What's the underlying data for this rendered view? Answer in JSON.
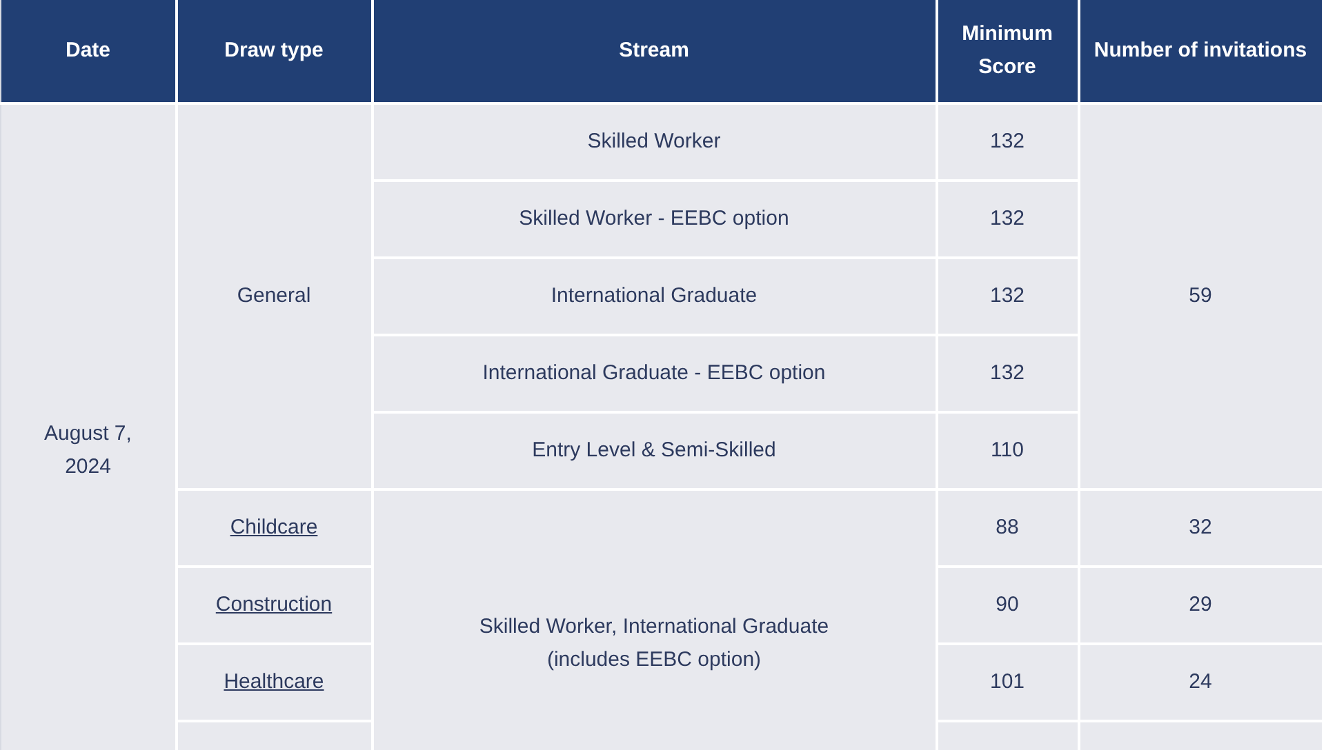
{
  "table": {
    "columns": [
      "Date",
      "Draw type",
      "Stream",
      "Minimum Score",
      "Number of invitations"
    ],
    "date": "August 7, 2024",
    "sections": [
      {
        "kind": "general",
        "draw_type": "General",
        "invitations": "59",
        "rows": [
          {
            "stream": "Skilled Worker",
            "score": "132"
          },
          {
            "stream": "Skilled Worker - EEBC option",
            "score": "132"
          },
          {
            "stream": "International Graduate",
            "score": "132"
          },
          {
            "stream": "International Graduate - EEBC option",
            "score": "132"
          },
          {
            "stream": "Entry Level & Semi-Skilled",
            "score": "110"
          }
        ]
      },
      {
        "kind": "occupation",
        "stream": "Skilled Worker, International Graduate (includes EEBC option)",
        "rows": [
          {
            "draw_type": "Childcare",
            "score": "88",
            "invitations": "32"
          },
          {
            "draw_type": "Construction",
            "score": "90",
            "invitations": "29"
          },
          {
            "draw_type": "Healthcare",
            "score": "101",
            "invitations": "24"
          }
        ]
      }
    ]
  }
}
